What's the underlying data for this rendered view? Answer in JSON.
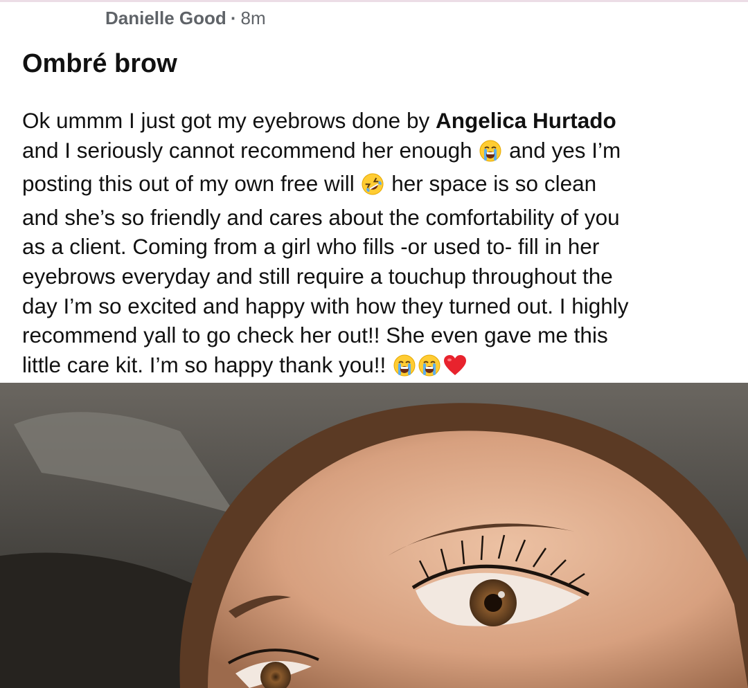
{
  "post": {
    "author": "Danielle Good",
    "separator": "·",
    "timestamp": "8m",
    "title": "Ombré brow",
    "body": {
      "l1_a": "Ok ummm I just got my eyebrows done by ",
      "mention": "Angelica Hurtado",
      "l2_a": "and I seriously cannot recommend her enough ",
      "l2_b": " and yes I’m",
      "l3_a": "posting this out of my own free will ",
      "l3_b": " her space is so clean",
      "l4": "and she’s so friendly and cares about the comfortability of you",
      "l5": "as a client. Coming from a girl who fills -or used to- fill in her",
      "l6": "eyebrows everyday and still require a touchup throughout the",
      "l7": "day I’m so excited and happy with how they turned out. I highly",
      "l8": "recommend yall to go check her out!! She even gave me this",
      "l9_a": "little care kit. I’m so happy thank you!! "
    },
    "emoji": {
      "crying": "loudly-crying-face-icon",
      "laughing": "rolling-on-floor-laughing-icon",
      "heart": "red-heart-icon"
    },
    "colors": {
      "meta": "#5f6368",
      "text": "#111111",
      "border": "#ecdde6"
    }
  }
}
